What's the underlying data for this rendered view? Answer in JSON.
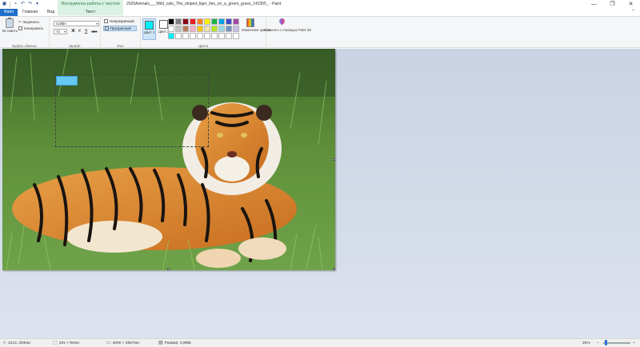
{
  "titlebar": {
    "contextual_title": "Инструменты работы с текстом",
    "window_title": "2020Animals___Wild_cats_The_striped_tiger_lies_on_a_green_grass_142355_ - Paint",
    "minimize": "—",
    "maximize": "❐",
    "close": "✕"
  },
  "tabs": {
    "file": "Файл",
    "home": "Главная",
    "view": "Вид",
    "text": "Текст"
  },
  "clipboard": {
    "paste": "Вставить",
    "cut": "Вырезать",
    "copy": "Копировать",
    "group_label": "Буфер обмена"
  },
  "font": {
    "family": "Calibri",
    "size": "72",
    "bold": "Ж",
    "italic": "К",
    "underline": "Ч",
    "strikethrough": "abc",
    "group_label": "Шрифт"
  },
  "background": {
    "opaque": "Непрозрачный",
    "transparent": "Прозрачный",
    "group_label": "Фон"
  },
  "colors": {
    "color1_label": "Цвет 1",
    "color2_label": "Цвет 2",
    "color1": "#00f0ff",
    "color2": "#ffffff",
    "palette": [
      "#000000",
      "#7f7f7f",
      "#880015",
      "#ed1c24",
      "#ff7f27",
      "#fff200",
      "#22b14c",
      "#00a2e8",
      "#3f48cc",
      "#a349a4",
      "#ffffff",
      "#c3c3c3",
      "#b97a57",
      "#ffaec9",
      "#ffc90e",
      "#efe4b0",
      "#b5e61d",
      "#99d9ea",
      "#7092be",
      "#c8bfe7",
      "#00f0ff",
      "#ffffff",
      "#ffffff",
      "#ffffff",
      "#ffffff",
      "#ffffff",
      "#ffffff",
      "#ffffff",
      "#ffffff",
      "#ffffff"
    ],
    "edit_colors": "Изменение цветов",
    "group_label": "Цвета"
  },
  "paint3d": {
    "label": "Изменить с помощью Paint 3D"
  },
  "status": {
    "cursor_pos": "1213, 293пкс",
    "selection_size": "181 × 94пкс",
    "image_size": "4000 × 2667пкс",
    "file_size": "Размер: 3,9МБ",
    "zoom": "25%",
    "zoom_out": "−",
    "zoom_in": "+"
  }
}
